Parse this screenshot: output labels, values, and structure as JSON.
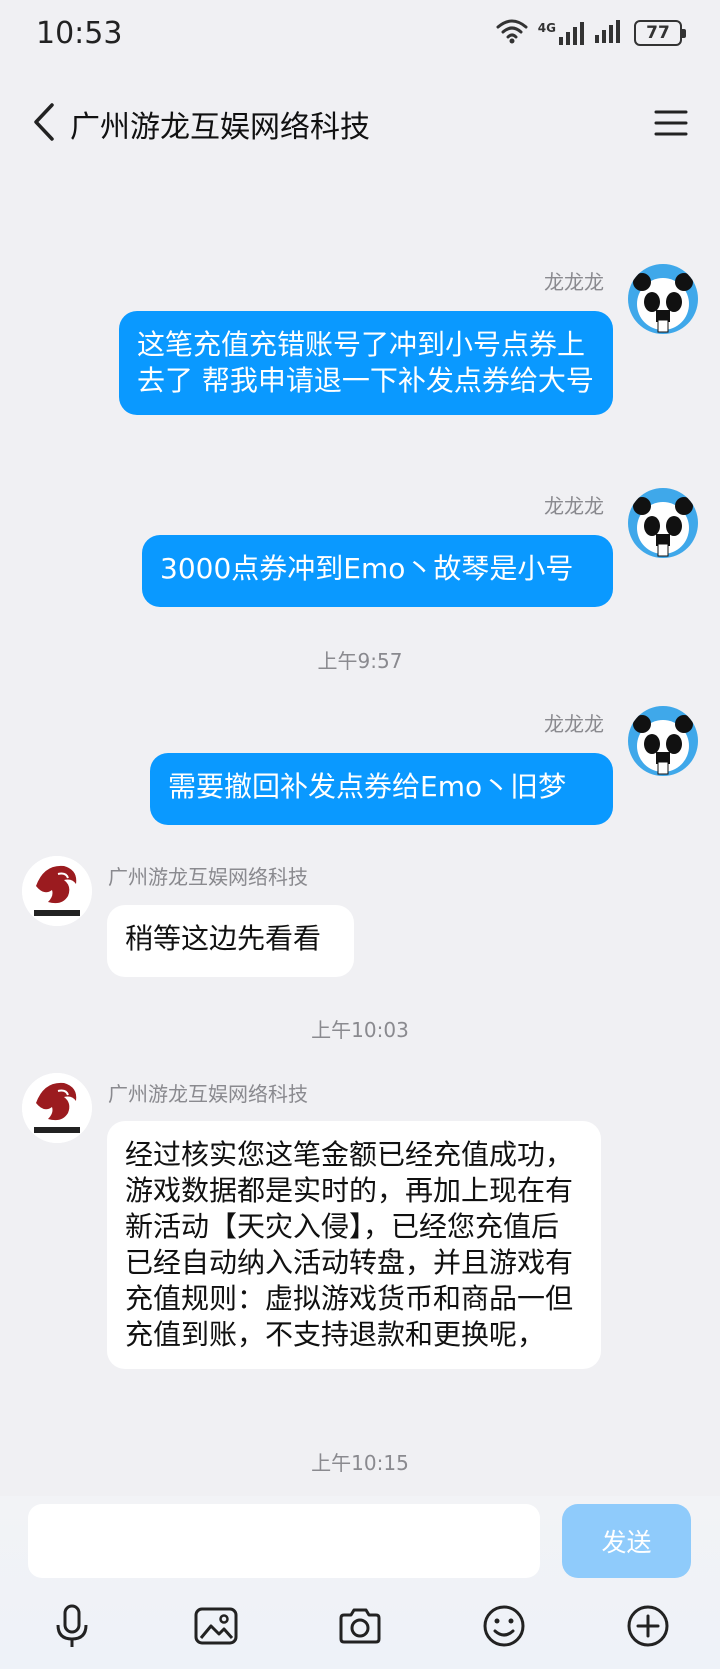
{
  "status_bar": {
    "time": "10:53",
    "network_label": "4G",
    "battery": "77"
  },
  "header": {
    "title": "广州游龙互娱网络科技"
  },
  "messages": [
    {
      "sender": "龙龙龙",
      "direction": "outgoing",
      "text": "这笔充值充错账号了冲到小号点券上去了 帮我申请退一下补发点券给大号"
    },
    {
      "sender": "龙龙龙",
      "direction": "outgoing",
      "text": "3000点券冲到Emo丶故琴是小号"
    },
    {
      "type": "timestamp",
      "text": "上午9:57"
    },
    {
      "sender": "龙龙龙",
      "direction": "outgoing",
      "text": "需要撤回补发点券给Emo丶旧梦"
    },
    {
      "sender": "广州游龙互娱网络科技",
      "direction": "incoming",
      "text": "稍等这边先看看"
    },
    {
      "type": "timestamp",
      "text": "上午10:03"
    },
    {
      "sender": "广州游龙互娱网络科技",
      "direction": "incoming",
      "text": "经过核实您这笔金额已经充值成功，游戏数据都是实时的，再加上现在有新活动【天灾入侵】，已经您充值后已经自动纳入活动转盘，并且游戏有充值规则：虚拟游戏货币和商品一但充值到账，不支持退款和更换呢，"
    },
    {
      "type": "timestamp",
      "text": "上午10:15"
    }
  ],
  "input": {
    "value": "",
    "send_label": "发送"
  },
  "toolbar": {
    "icons": [
      "microphone-icon",
      "image-icon",
      "camera-icon",
      "emoji-icon",
      "plus-icon"
    ]
  },
  "colors": {
    "outgoing_bubble": "#0a99ff",
    "incoming_bubble": "#ffffff",
    "background": "#f0f0f3",
    "send_button": "#8fcbfb"
  }
}
